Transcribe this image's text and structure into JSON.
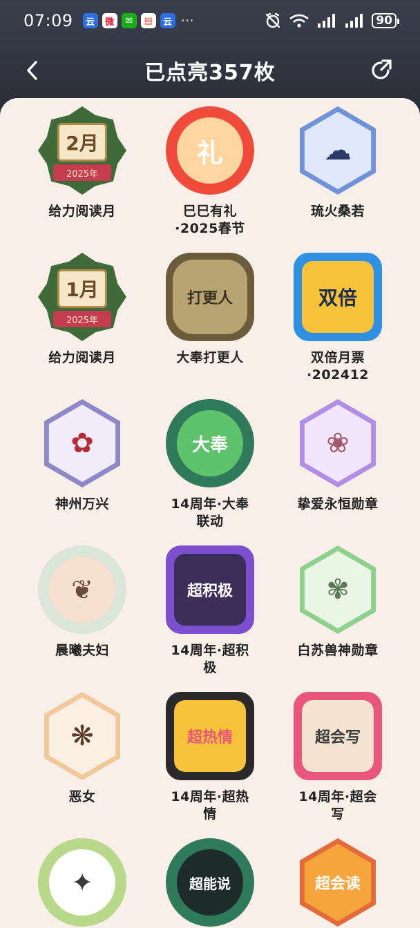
{
  "status": {
    "time": "07:09",
    "apps": [
      {
        "name": "app-icon-1",
        "glyph": "云",
        "bg": "#2b6fe0",
        "fg": "#ffffff"
      },
      {
        "name": "weibo-icon",
        "glyph": "微",
        "bg": "#ffffff",
        "fg": "#e6162d"
      },
      {
        "name": "wechat-icon",
        "glyph": "✉",
        "bg": "#1aad19",
        "fg": "#ffffff"
      },
      {
        "name": "calendar-icon",
        "glyph": "▤",
        "bg": "#ffffff",
        "fg": "#e34b3b"
      },
      {
        "name": "app-icon-2",
        "glyph": "云",
        "bg": "#2b6fe0",
        "fg": "#ffffff"
      }
    ],
    "more": "···",
    "alarm_icon": "alarm-off-icon",
    "wifi_icon": "wifi-icon",
    "signal_icon": "signal-icon",
    "battery": "90"
  },
  "nav": {
    "title": "已点亮357枚",
    "back_icon": "chevron-left-icon",
    "share_icon": "share-icon"
  },
  "badges": [
    {
      "label": "给力阅读月",
      "style": "month",
      "text": "2月",
      "sub": "2025年",
      "colors": [
        "#3f6b3a",
        "#c53c4e",
        "#f6e7c8"
      ]
    },
    {
      "label": "巳巳有礼\n·2025春节",
      "style": "circle",
      "text": "礼",
      "colors": [
        "#f04a3a",
        "#ffd6a0",
        "#ffffff"
      ]
    },
    {
      "label": "琉火桑若",
      "style": "hex",
      "text": "☁",
      "colors": [
        "#6f92d8",
        "#dfe9fb",
        "#2a3a6b"
      ]
    },
    {
      "label": "给力阅读月",
      "style": "month",
      "text": "1月",
      "sub": "2025年",
      "colors": [
        "#3f6b3a",
        "#c53c4e",
        "#f6e7c8"
      ]
    },
    {
      "label": "大奉打更人",
      "style": "coin",
      "text": "打更人",
      "colors": [
        "#6b5c3b",
        "#b8a472",
        "#3b3322"
      ]
    },
    {
      "label": "双倍月票\n·202412",
      "style": "square",
      "text": "双倍",
      "colors": [
        "#2f8fe0",
        "#f6c23a",
        "#1b2d4f"
      ]
    },
    {
      "label": "神州万兴",
      "style": "hex",
      "text": "✿",
      "colors": [
        "#8f88c8",
        "#f0ecfa",
        "#b52a35"
      ]
    },
    {
      "label": "14周年·大奉\n联动",
      "style": "circle",
      "text": "大奉",
      "colors": [
        "#2f7a5a",
        "#5dc26a",
        "#ffffff"
      ]
    },
    {
      "label": "挚爱永恒勋章",
      "style": "hex",
      "text": "❀",
      "colors": [
        "#b08ee6",
        "#f1e6fb",
        "#a2596a"
      ]
    },
    {
      "label": "晨曦夫妇",
      "style": "circle",
      "text": "❦",
      "colors": [
        "#d9e6d8",
        "#f6e1d0",
        "#6b4a3a"
      ]
    },
    {
      "label": "14周年·超积\n极",
      "style": "square",
      "text": "超积极",
      "colors": [
        "#7c4fcf",
        "#3b2f5a",
        "#ffffff"
      ]
    },
    {
      "label": "白苏兽神勋章",
      "style": "hex",
      "text": "✾",
      "colors": [
        "#8ed08e",
        "#e9f6e3",
        "#5a7a5a"
      ]
    },
    {
      "label": "恶女",
      "style": "hex",
      "text": "❋",
      "colors": [
        "#f0c89a",
        "#fbefe2",
        "#5b3a2a"
      ]
    },
    {
      "label": "14周年·超热\n情",
      "style": "square",
      "text": "超热情",
      "colors": [
        "#2a2a2a",
        "#f6c23a",
        "#e8577b"
      ]
    },
    {
      "label": "14周年·超会\n写",
      "style": "square",
      "text": "超会写",
      "colors": [
        "#e8577b",
        "#f4e3d0",
        "#3a3a3a"
      ]
    },
    {
      "label": "",
      "style": "circle",
      "text": "✦",
      "colors": [
        "#b8d98a",
        "#ffffff",
        "#3a3a3a"
      ]
    },
    {
      "label": "",
      "style": "circle",
      "text": "超能说",
      "colors": [
        "#2f7a5a",
        "#1d2b2a",
        "#ffffff"
      ]
    },
    {
      "label": "",
      "style": "hex",
      "text": "超会读",
      "colors": [
        "#e36a3a",
        "#f6a53a",
        "#ffffff"
      ]
    }
  ]
}
